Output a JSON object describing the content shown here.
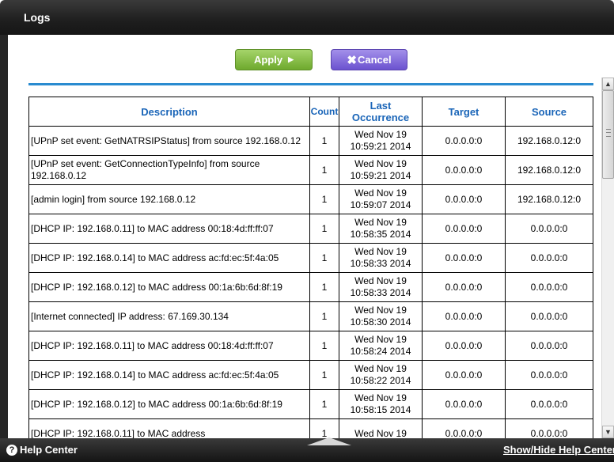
{
  "window": {
    "title": "Logs"
  },
  "buttons": {
    "apply": "Apply",
    "cancel": "Cancel"
  },
  "table": {
    "headers": {
      "description": "Description",
      "count": "Count",
      "last_line1": "Last",
      "last_line2": "Occurrence",
      "target": "Target",
      "source": "Source"
    },
    "rows": [
      {
        "description": "[UPnP set event: GetNATRSIPStatus] from source 192.168.0.12",
        "count": "1",
        "date": "Wed Nov 19",
        "time": "10:59:21 2014",
        "target": "0.0.0.0:0",
        "source": "192.168.0.12:0"
      },
      {
        "description": "[UPnP set event: GetConnectionTypeInfo] from source 192.168.0.12",
        "count": "1",
        "date": "Wed Nov 19",
        "time": "10:59:21 2014",
        "target": "0.0.0.0:0",
        "source": "192.168.0.12:0"
      },
      {
        "description": "[admin login] from source 192.168.0.12",
        "count": "1",
        "date": "Wed Nov 19",
        "time": "10:59:07 2014",
        "target": "0.0.0.0:0",
        "source": "192.168.0.12:0"
      },
      {
        "description": "[DHCP IP: 192.168.0.11] to MAC address 00:18:4d:ff:ff:07",
        "count": "1",
        "date": "Wed Nov 19",
        "time": "10:58:35 2014",
        "target": "0.0.0.0:0",
        "source": "0.0.0.0:0"
      },
      {
        "description": "[DHCP IP: 192.168.0.14] to MAC address ac:fd:ec:5f:4a:05",
        "count": "1",
        "date": "Wed Nov 19",
        "time": "10:58:33 2014",
        "target": "0.0.0.0:0",
        "source": "0.0.0.0:0"
      },
      {
        "description": "[DHCP IP: 192.168.0.12] to MAC address 00:1a:6b:6d:8f:19",
        "count": "1",
        "date": "Wed Nov 19",
        "time": "10:58:33 2014",
        "target": "0.0.0.0:0",
        "source": "0.0.0.0:0"
      },
      {
        "description": "[Internet connected] IP address: 67.169.30.134",
        "count": "1",
        "date": "Wed Nov 19",
        "time": "10:58:30 2014",
        "target": "0.0.0.0:0",
        "source": "0.0.0.0:0"
      },
      {
        "description": "[DHCP IP: 192.168.0.11] to MAC address 00:18:4d:ff:ff:07",
        "count": "1",
        "date": "Wed Nov 19",
        "time": "10:58:24 2014",
        "target": "0.0.0.0:0",
        "source": "0.0.0.0:0"
      },
      {
        "description": "[DHCP IP: 192.168.0.14] to MAC address ac:fd:ec:5f:4a:05",
        "count": "1",
        "date": "Wed Nov 19",
        "time": "10:58:22 2014",
        "target": "0.0.0.0:0",
        "source": "0.0.0.0:0"
      },
      {
        "description": "[DHCP IP: 192.168.0.12] to MAC address 00:1a:6b:6d:8f:19",
        "count": "1",
        "date": "Wed Nov 19",
        "time": "10:58:15 2014",
        "target": "0.0.0.0:0",
        "source": "0.0.0.0:0"
      },
      {
        "description": "[DHCP IP: 192.168.0.11] to MAC address",
        "count": "1",
        "date": "Wed Nov 19",
        "time": "",
        "target": "0.0.0.0:0",
        "source": "0.0.0.0:0"
      }
    ]
  },
  "footer": {
    "help_center": "Help Center",
    "show_hide": "Show/Hide Help Center"
  },
  "colors": {
    "apply_green": "#7db83b",
    "cancel_purple": "#7a63d6",
    "header_blue": "#1a65b8",
    "rule_blue": "#2a8bd0"
  },
  "icons": {
    "apply_arrow": "play-arrow-icon",
    "cancel_x": "x-icon",
    "help": "question-circle-icon"
  }
}
